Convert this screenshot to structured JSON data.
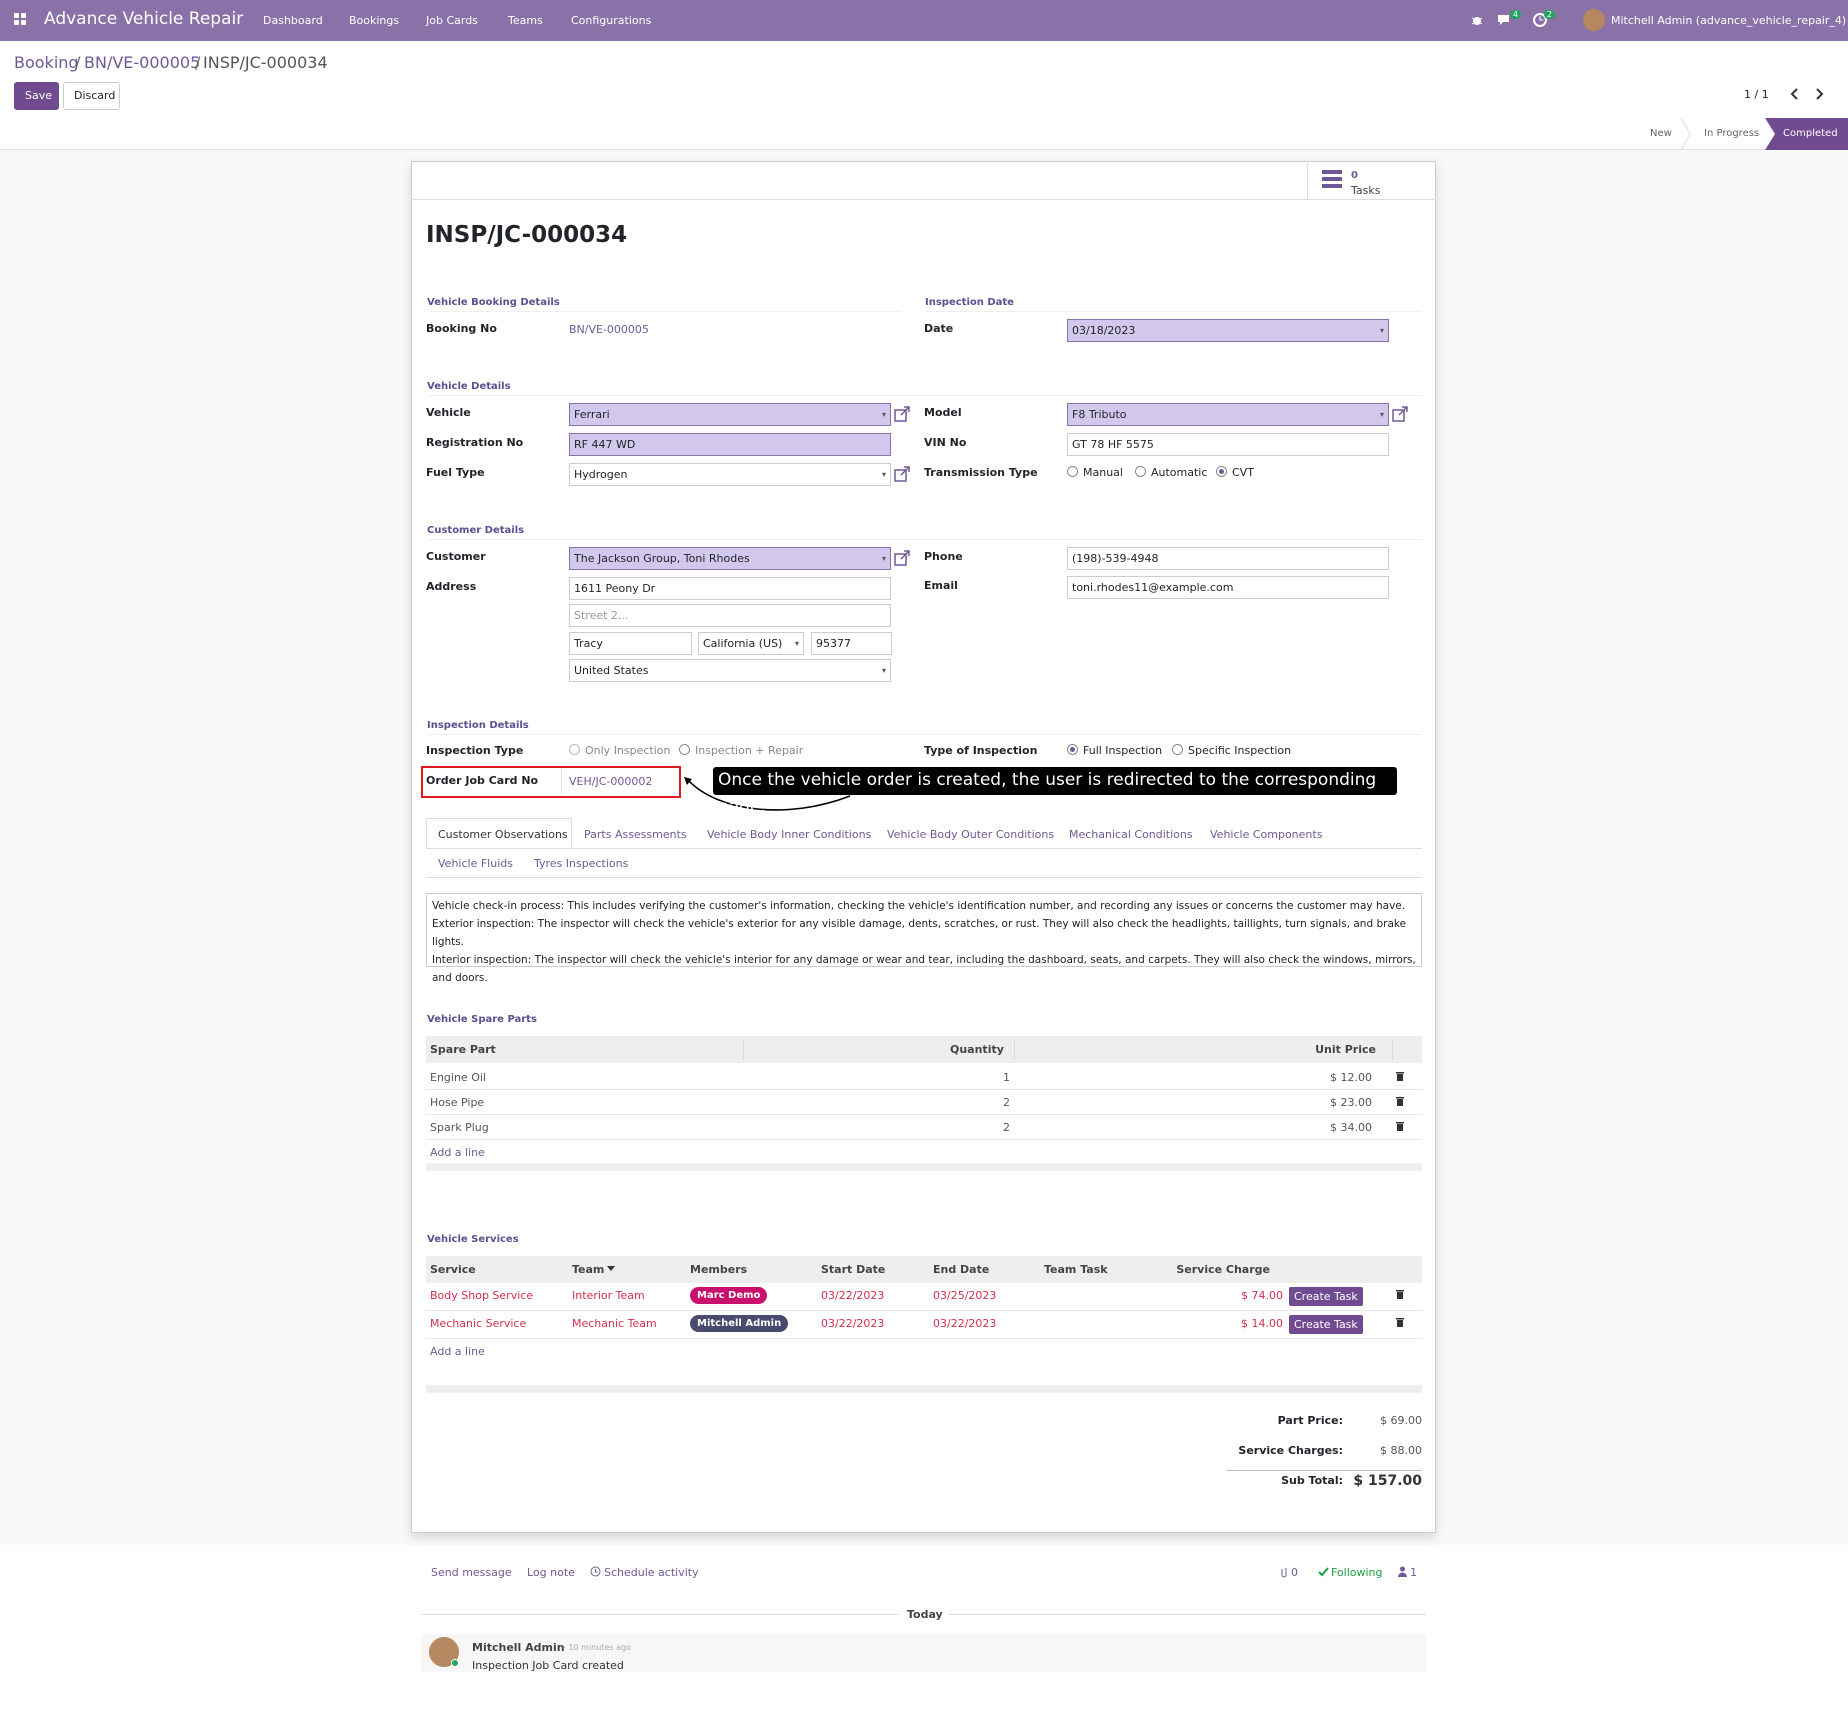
{
  "navbar": {
    "app_name": "Advance Vehicle Repair",
    "menu": [
      "Dashboard",
      "Bookings",
      "Job Cards",
      "Teams",
      "Configurations"
    ],
    "chat_count": "4",
    "activity_count": "2",
    "user": "Mitchell Admin (advance_vehicle_repair_4)"
  },
  "breadcrumb": {
    "root": "Booking",
    "parent": "BN/VE-000005",
    "current": "INSP/JC-000034"
  },
  "actions": {
    "save": "Save",
    "discard": "Discard",
    "pager": "1 / 1"
  },
  "statusbar": [
    "New",
    "In Progress",
    "Completed"
  ],
  "stat_button": {
    "count": "0",
    "label": "Tasks"
  },
  "record_title": "INSP/JC-000034",
  "booking": {
    "section": "Vehicle Booking Details",
    "booking_no_label": "Booking No",
    "booking_no": "BN/VE-000005"
  },
  "inspection_date": {
    "section": "Inspection Date",
    "date_label": "Date",
    "date": "03/18/2023"
  },
  "vehicle": {
    "section": "Vehicle Details",
    "vehicle_label": "Vehicle",
    "vehicle": "Ferrari",
    "reg_label": "Registration No",
    "reg": "RF 447 WD",
    "fuel_label": "Fuel Type",
    "fuel": "Hydrogen",
    "model_label": "Model",
    "model": "F8 Tributo",
    "vin_label": "VIN No",
    "vin": "GT 78 HF 5575",
    "transmission_label": "Transmission Type",
    "transmission_options": [
      "Manual",
      "Automatic",
      "CVT"
    ],
    "transmission_selected": "CVT"
  },
  "customer": {
    "section": "Customer Details",
    "customer_label": "Customer",
    "customer": "The Jackson Group, Toni Rhodes",
    "address_label": "Address",
    "street": "1611 Peony Dr",
    "street2_placeholder": "Street 2...",
    "city": "Tracy",
    "state": "California (US)",
    "zip": "95377",
    "country": "United States",
    "phone_label": "Phone",
    "phone": "(198)-539-4948",
    "email_label": "Email",
    "email": "toni.rhodes11@example.com"
  },
  "inspection": {
    "section": "Inspection Details",
    "type_label": "Inspection Type",
    "type_options": [
      "Only Inspection",
      "Inspection + Repair"
    ],
    "kind_label": "Type of Inspection",
    "kind_options": [
      "Full Inspection",
      "Specific Inspection"
    ],
    "kind_selected": "Full Inspection",
    "order_label": "Order Job Card No",
    "order_no": "VEH/JC-000002"
  },
  "callout": "Once the vehicle order is created, the user is redirected to the corresponding page.",
  "tabs": [
    "Customer Observations",
    "Parts Assessments",
    "Vehicle Body Inner Conditions",
    "Vehicle Body Outer Conditions",
    "Mechanical Conditions",
    "Vehicle Components",
    "Vehicle Fluids",
    "Tyres Inspections"
  ],
  "observations": [
    "Vehicle check-in process: This includes verifying the customer's information, checking the vehicle's identification number, and recording any issues or concerns the customer may have.",
    "Exterior inspection: The inspector will check the vehicle's exterior for any visible damage, dents, scratches, or rust. They will also check the headlights, taillights, turn signals, and brake lights.",
    "Interior inspection: The inspector will check the vehicle's interior for any damage or wear and tear, including the dashboard, seats, and carpets. They will also check the windows, mirrors, and doors."
  ],
  "spare_parts": {
    "section": "Vehicle Spare Parts",
    "headers": [
      "Spare Part",
      "Quantity",
      "Unit Price"
    ],
    "rows": [
      {
        "part": "Engine Oil",
        "qty": "1",
        "price": "$ 12.00"
      },
      {
        "part": "Hose Pipe",
        "qty": "2",
        "price": "$ 23.00"
      },
      {
        "part": "Spark Plug",
        "qty": "2",
        "price": "$ 34.00"
      }
    ],
    "add_line": "Add a line"
  },
  "services": {
    "section": "Vehicle Services",
    "headers": [
      "Service",
      "Team",
      "Members",
      "Start Date",
      "End Date",
      "Team Task",
      "Service Charge"
    ],
    "rows": [
      {
        "service": "Body Shop Service",
        "team": "Interior Team",
        "member": "Marc Demo",
        "start": "03/22/2023",
        "end": "03/25/2023",
        "charge": "$ 74.00",
        "action": "Create Task"
      },
      {
        "service": "Mechanic Service",
        "team": "Mechanic Team",
        "member": "Mitchell Admin",
        "start": "03/22/2023",
        "end": "03/22/2023",
        "charge": "$ 14.00",
        "action": "Create Task"
      }
    ],
    "add_line": "Add a line"
  },
  "totals": {
    "part_label": "Part Price:",
    "part": "$ 69.00",
    "service_label": "Service Charges:",
    "service": "$ 88.00",
    "sub_label": "Sub Total:",
    "sub": "$ 157.00"
  },
  "chatter": {
    "send": "Send message",
    "log": "Log note",
    "schedule": "Schedule activity",
    "attachments": "0",
    "following": "Following",
    "followers": "1",
    "day": "Today",
    "author": "Mitchell Admin",
    "time": "- 10 minutes ago",
    "message": "Inspection Job Card created"
  },
  "colors": {
    "brand": "#8a72a8",
    "primary": "#714b92",
    "required": "#d2c8ee",
    "danger": "#d0314e",
    "highlight": "#e0181f"
  }
}
